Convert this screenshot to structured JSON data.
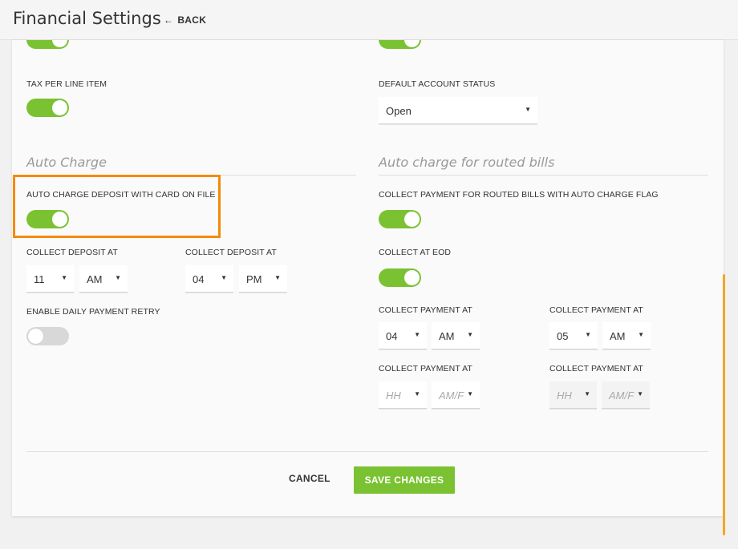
{
  "header": {
    "title": "Financial Settings",
    "back_label": "BACK"
  },
  "left": {
    "tax_per_line_item": {
      "label": "TAX PER LINE ITEM",
      "enabled": true
    },
    "auto_charge_section": "Auto Charge",
    "auto_charge_deposit": {
      "label": "AUTO CHARGE DEPOSIT WITH CARD ON FILE",
      "enabled": true
    },
    "collect_deposit_1": {
      "label": "COLLECT DEPOSIT AT",
      "hour": "11",
      "ampm": "AM"
    },
    "collect_deposit_2": {
      "label": "COLLECT DEPOSIT AT",
      "hour": "04",
      "ampm": "PM"
    },
    "daily_retry": {
      "label": "ENABLE DAILY PAYMENT RETRY",
      "enabled": false
    }
  },
  "right": {
    "default_account_status": {
      "label": "DEFAULT ACCOUNT STATUS",
      "value": "Open"
    },
    "routed_section": "Auto charge for routed bills",
    "collect_routed": {
      "label": "COLLECT PAYMENT FOR ROUTED BILLS WITH AUTO CHARGE FLAG",
      "enabled": true
    },
    "collect_eod": {
      "label": "COLLECT AT EOD",
      "enabled": true
    },
    "payment_1": {
      "label": "COLLECT PAYMENT AT",
      "hour": "04",
      "ampm": "AM"
    },
    "payment_2": {
      "label": "COLLECT PAYMENT AT",
      "hour": "05",
      "ampm": "AM"
    },
    "payment_3": {
      "label": "COLLECT PAYMENT AT",
      "hour": "HH",
      "ampm": "AM/F"
    },
    "payment_4": {
      "label": "COLLECT PAYMENT AT",
      "hour": "HH",
      "ampm": "AM/F"
    }
  },
  "footer": {
    "cancel_label": "CANCEL",
    "save_label": "SAVE CHANGES"
  },
  "colors": {
    "accent_green": "#7ac231",
    "highlight_orange": "#f58a07",
    "scrollbar": "#f5a623"
  },
  "icons": {
    "back": "arrow-left-icon",
    "dropdown": "caret-down-icon"
  }
}
